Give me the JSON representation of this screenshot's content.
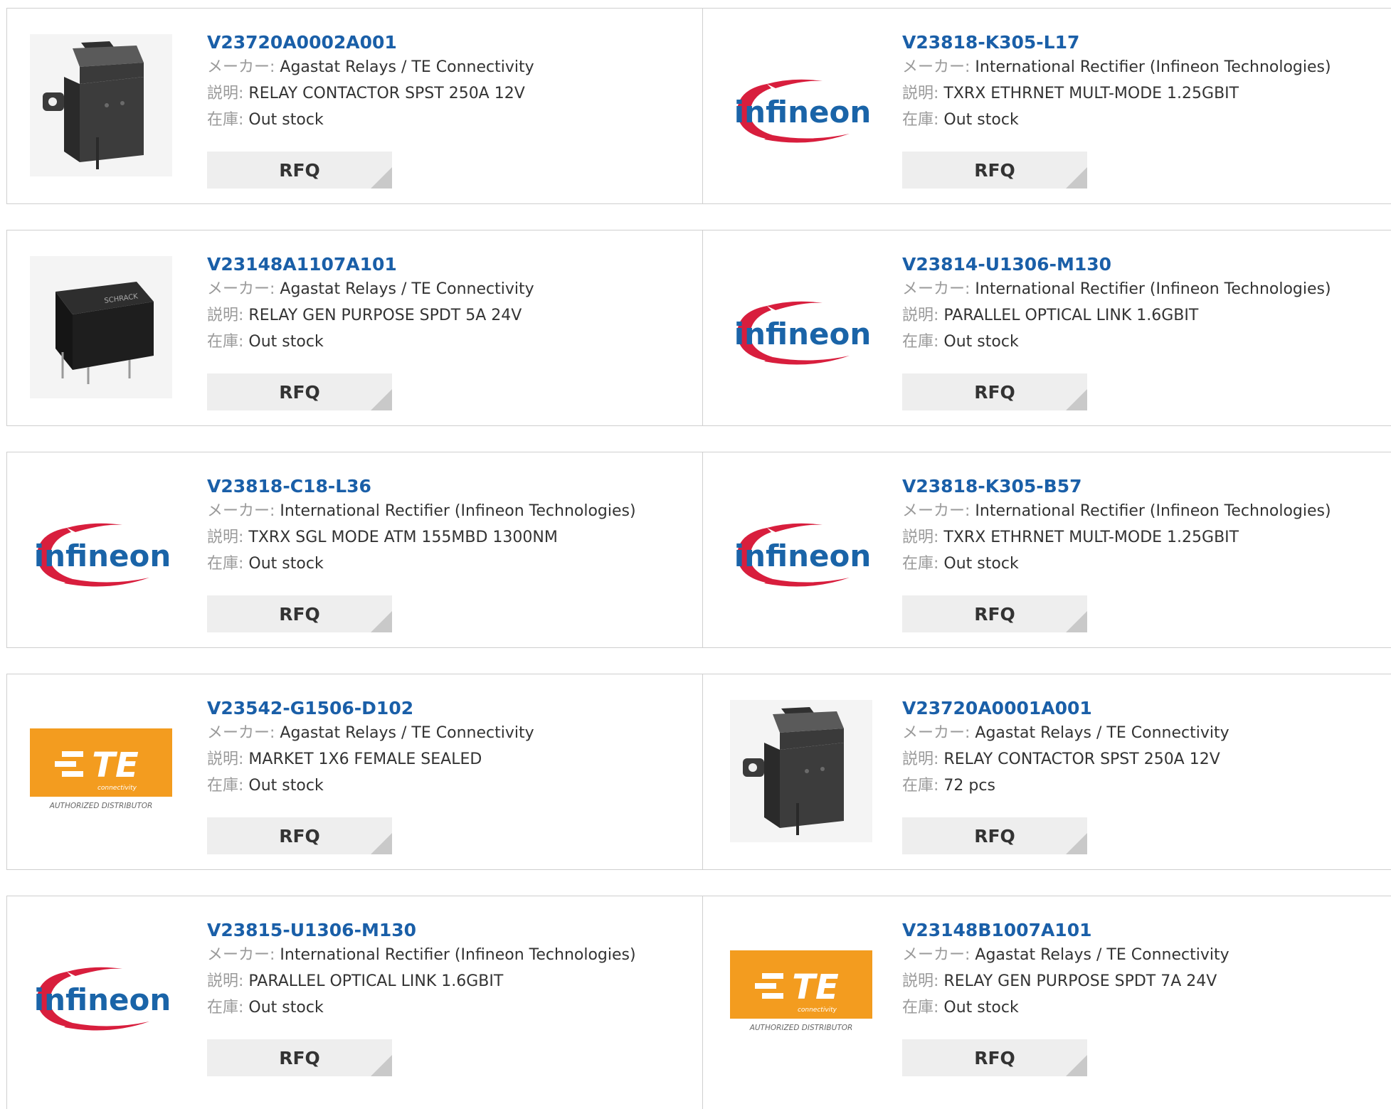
{
  "labels": {
    "manufacturer": "メーカー:",
    "description": "説明:",
    "stock": "在庫:",
    "rfq": "RFQ"
  },
  "colors": {
    "part_link": "#1a5fa8",
    "border": "#cfcfcf",
    "rfq_bg": "#eeeeee",
    "te_orange": "#f39c1f",
    "infineon_red": "#d81e3d",
    "infineon_blue": "#1a64a8"
  },
  "products": [
    {
      "part": "V23720A0002A001",
      "manufacturer": "Agastat Relays / TE Connectivity",
      "description": "RELAY CONTACTOR SPST 250A 12V",
      "stock": "Out stock",
      "image": "relay-contactor"
    },
    {
      "part": "V23818-K305-L17",
      "manufacturer": "International Rectifier (Infineon Technologies)",
      "description": "TXRX ETHRNET MULT-MODE 1.25GBIT",
      "stock": "Out stock",
      "image": "infineon-logo"
    },
    {
      "part": "V23148A1107A101",
      "manufacturer": "Agastat Relays / TE Connectivity",
      "description": "RELAY GEN PURPOSE SPDT 5A 24V",
      "stock": "Out stock",
      "image": "relay-schrack",
      "image_text": "SCHRACK"
    },
    {
      "part": "V23814-U1306-M130",
      "manufacturer": "International Rectifier (Infineon Technologies)",
      "description": "PARALLEL OPTICAL LINK 1.6GBIT",
      "stock": "Out stock",
      "image": "infineon-logo"
    },
    {
      "part": "V23818-C18-L36",
      "manufacturer": "International Rectifier (Infineon Technologies)",
      "description": "TXRX SGL MODE ATM 155MBD 1300NM",
      "stock": "Out stock",
      "image": "infineon-logo"
    },
    {
      "part": "V23818-K305-B57",
      "manufacturer": "International Rectifier (Infineon Technologies)",
      "description": "TXRX ETHRNET MULT-MODE 1.25GBIT",
      "stock": "Out stock",
      "image": "infineon-logo"
    },
    {
      "part": "V23542-G1506-D102",
      "manufacturer": "Agastat Relays / TE Connectivity",
      "description": "MARKET 1X6 FEMALE SEALED",
      "stock": "Out stock",
      "image": "te-logo"
    },
    {
      "part": "V23720A0001A001",
      "manufacturer": "Agastat Relays / TE Connectivity",
      "description": "RELAY CONTACTOR SPST 250A 12V",
      "stock": "72 pcs",
      "image": "relay-contactor"
    },
    {
      "part": "V23815-U1306-M130",
      "manufacturer": "International Rectifier (Infineon Technologies)",
      "description": "PARALLEL OPTICAL LINK 1.6GBIT",
      "stock": "Out stock",
      "image": "infineon-logo"
    },
    {
      "part": "V23148B1007A101",
      "manufacturer": "Agastat Relays / TE Connectivity",
      "description": "RELAY GEN PURPOSE SPDT 7A 24V",
      "stock": "Out stock",
      "image": "te-logo"
    }
  ],
  "logos": {
    "infineon": "infineon",
    "te_mark": "TE",
    "te_sub": "connectivity",
    "te_caption": "AUTHORIZED DISTRIBUTOR"
  }
}
